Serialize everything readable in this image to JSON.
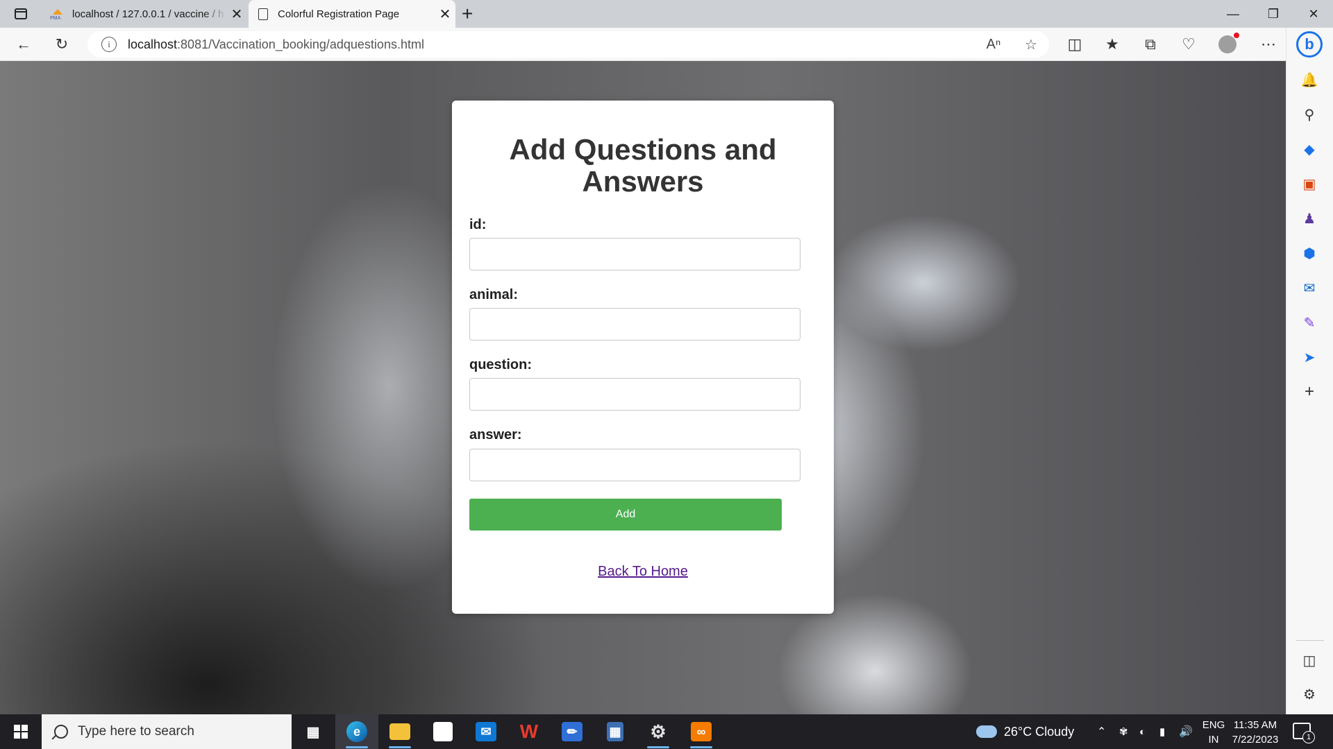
{
  "browser": {
    "tabs": [
      {
        "label": "localhost / 127.0.0.1 / vaccine / h",
        "icon": "phpmyadmin-icon",
        "favicon_text": "PMA"
      },
      {
        "label": "Colorful Registration Page",
        "icon": "document-icon"
      }
    ],
    "tab_close_glyph": "✕",
    "new_tab_glyph": "+",
    "address": {
      "host": "localhost",
      "path": ":8081/Vaccination_booking/adquestions.html"
    }
  },
  "form": {
    "title": "Add Questions and Answers",
    "fields": [
      {
        "label": "id:",
        "value": ""
      },
      {
        "label": "animal:",
        "value": ""
      },
      {
        "label": "question:",
        "value": ""
      },
      {
        "label": "answer:",
        "value": ""
      }
    ],
    "submit_label": "Add",
    "back_link": "Back To Home"
  },
  "taskbar": {
    "search_placeholder": "Type here to search",
    "weather": "26°C  Cloudy",
    "language": {
      "top": "ENG",
      "bottom": "IN"
    },
    "clock": {
      "time": "11:35 AM",
      "date": "7/22/2023"
    },
    "notification_count": "1",
    "apps": [
      "task-view",
      "edge",
      "file-explorer",
      "microsoft-store",
      "mail",
      "wps-office",
      "draw",
      "calculator",
      "settings-gear",
      "xampp"
    ]
  },
  "colors": {
    "submit_button": "#4caf50",
    "link_visited": "#551a8b",
    "accent": "#1a73e8"
  }
}
